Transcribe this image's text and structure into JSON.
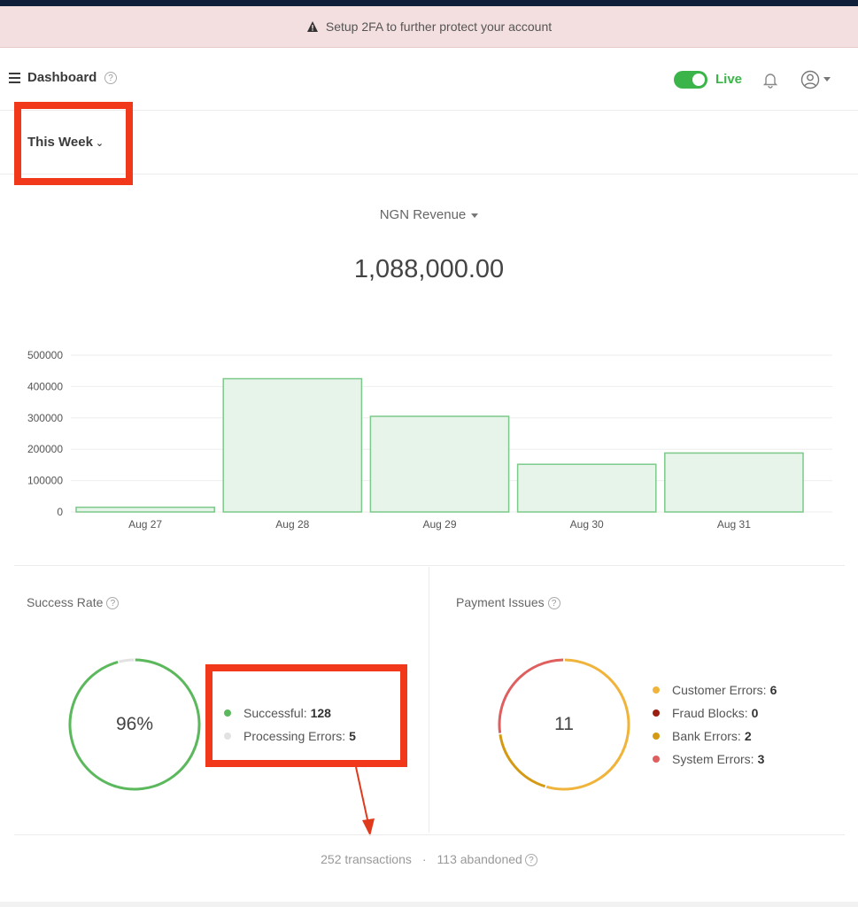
{
  "banner": {
    "text": "Setup 2FA to further protect your account"
  },
  "header": {
    "title": "Dashboard",
    "live_label": "Live",
    "help": "?"
  },
  "filter": {
    "label": "This Week"
  },
  "revenue": {
    "selector": "NGN Revenue",
    "amount": "1,088,000.00"
  },
  "chart_data": {
    "type": "bar",
    "categories": [
      "Aug 27",
      "Aug 28",
      "Aug 29",
      "Aug 30",
      "Aug 31"
    ],
    "values": [
      15000,
      425000,
      305000,
      152000,
      188000
    ],
    "yticks": [
      "500000",
      "400000",
      "300000",
      "200000",
      "100000",
      "0"
    ],
    "ylim": [
      0,
      500000
    ],
    "grid": true,
    "bar_color": "#e6f4ea",
    "bar_border": "#7cc98a"
  },
  "success_rate": {
    "title": "Success Rate",
    "percent_label": "96%",
    "percent": 96,
    "legend": [
      {
        "label": "Successful:",
        "value": "128",
        "color": "#5cb85c"
      },
      {
        "label": "Processing Errors:",
        "value": "5",
        "color": "#e2e2e2"
      }
    ]
  },
  "payment_issues": {
    "title": "Payment Issues",
    "total": "11",
    "legend": [
      {
        "label": "Customer Errors:",
        "value": "6",
        "color": "#f0b43c"
      },
      {
        "label": "Fraud Blocks:",
        "value": "0",
        "color": "#9b1e12"
      },
      {
        "label": "Bank Errors:",
        "value": "2",
        "color": "#d49a14"
      },
      {
        "label": "System Errors:",
        "value": "3",
        "color": "#df5e5e"
      }
    ]
  },
  "footer": {
    "transactions": "252 transactions",
    "separator": "·",
    "abandoned": "113 abandoned"
  }
}
